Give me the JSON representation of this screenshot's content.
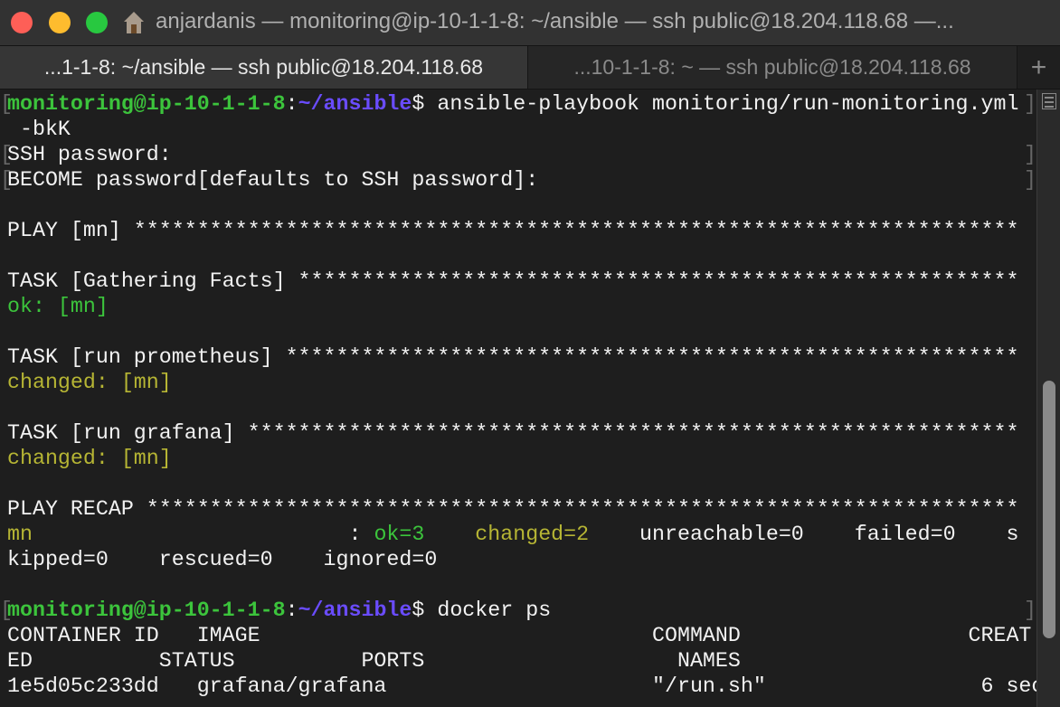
{
  "window": {
    "title": "anjardanis — monitoring@ip-10-1-1-8: ~/ansible — ssh public@18.204.118.68 —...",
    "traffic_lights": {
      "close": "#fe5f57",
      "minimize": "#febc2e",
      "maximize": "#28c840"
    }
  },
  "tabs": [
    {
      "label": "...1-1-8: ~/ansible — ssh public@18.204.118.68",
      "active": true
    },
    {
      "label": "...10-1-1-8: ~ — ssh public@18.204.118.68",
      "active": false
    }
  ],
  "new_tab_label": "+",
  "colors": {
    "green": "#3cc43c",
    "blue": "#6a4cff",
    "yellow": "#b6b534",
    "white": "#f2f2f2"
  },
  "terminal": {
    "lines": [
      {
        "brackets": true,
        "segs": [
          [
            "monitoring@ip-10-1-1-8",
            "green"
          ],
          [
            ":",
            "white"
          ],
          [
            "~/ansible",
            "blue"
          ],
          [
            "$ ansible-playbook monitoring/run-monitoring.yml",
            "white"
          ]
        ]
      },
      {
        "segs": [
          [
            " -bkK",
            "white"
          ]
        ]
      },
      {
        "brackets": true,
        "segs": [
          [
            "SSH password:",
            "white"
          ]
        ]
      },
      {
        "brackets": true,
        "segs": [
          [
            "BECOME password[defaults to SSH password]:",
            "white"
          ]
        ]
      },
      {
        "segs": []
      },
      {
        "segs": [
          [
            "PLAY [mn] **********************************************************************",
            "white"
          ]
        ]
      },
      {
        "segs": []
      },
      {
        "segs": [
          [
            "TASK [Gathering Facts] *********************************************************",
            "white"
          ]
        ]
      },
      {
        "segs": [
          [
            "ok: [mn]",
            "green"
          ]
        ]
      },
      {
        "segs": []
      },
      {
        "segs": [
          [
            "TASK [run prometheus] **********************************************************",
            "white"
          ]
        ]
      },
      {
        "segs": [
          [
            "changed: [mn]",
            "yellow"
          ]
        ]
      },
      {
        "segs": []
      },
      {
        "segs": [
          [
            "TASK [run grafana] *************************************************************",
            "white"
          ]
        ]
      },
      {
        "segs": [
          [
            "changed: [mn]",
            "yellow"
          ]
        ]
      },
      {
        "segs": []
      },
      {
        "segs": [
          [
            "PLAY RECAP *********************************************************************",
            "white"
          ]
        ]
      },
      {
        "segs": [
          [
            "mn",
            "yellow"
          ],
          [
            "                         : ",
            "white"
          ],
          [
            "ok=3",
            "green"
          ],
          [
            "    ",
            "white"
          ],
          [
            "changed=2",
            "yellow"
          ],
          [
            "    unreachable=0    failed=0    s",
            "white"
          ]
        ]
      },
      {
        "segs": [
          [
            "kipped=0    rescued=0    ignored=0",
            "white"
          ]
        ]
      },
      {
        "segs": []
      },
      {
        "brackets": true,
        "segs": [
          [
            "monitoring@ip-10-1-1-8",
            "green"
          ],
          [
            ":",
            "white"
          ],
          [
            "~/ansible",
            "blue"
          ],
          [
            "$ docker ps",
            "white"
          ]
        ]
      },
      {
        "segs": [
          [
            "CONTAINER ID   IMAGE                               COMMAND                  CREAT",
            "white"
          ]
        ]
      },
      {
        "segs": [
          [
            "ED          STATUS          PORTS                    NAMES",
            "white"
          ]
        ]
      },
      {
        "segs": [
          [
            "1e5d05c233dd   grafana/grafana                     \"/run.sh\"                 6 sec",
            "white"
          ]
        ]
      }
    ]
  }
}
